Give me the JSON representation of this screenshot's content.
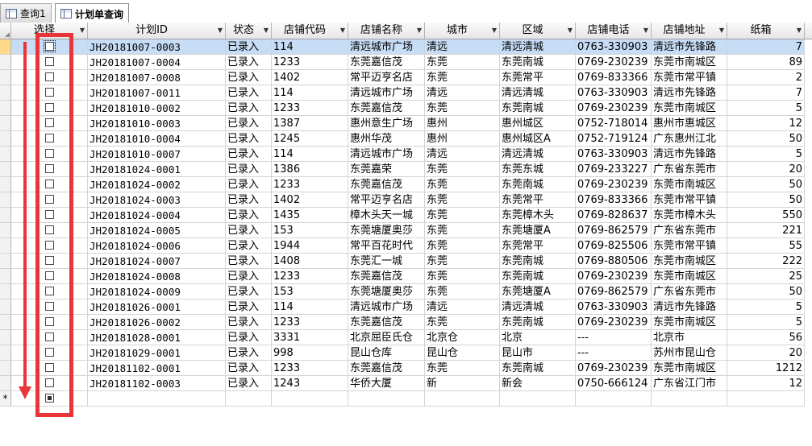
{
  "tabs": [
    {
      "label": "查询1",
      "active": false
    },
    {
      "label": "计划单查询",
      "active": true
    }
  ],
  "columns": [
    {
      "key": "select",
      "label": "选择"
    },
    {
      "key": "plan_id",
      "label": "计划ID"
    },
    {
      "key": "status",
      "label": "状态"
    },
    {
      "key": "store_code",
      "label": "店铺代码"
    },
    {
      "key": "store_name",
      "label": "店铺名称"
    },
    {
      "key": "city",
      "label": "城市"
    },
    {
      "key": "region",
      "label": "区域"
    },
    {
      "key": "phone",
      "label": "店铺电话"
    },
    {
      "key": "address",
      "label": "店铺地址"
    },
    {
      "key": "boxes",
      "label": "纸箱"
    }
  ],
  "rows": [
    [
      "JH20181007-0003",
      "已录入",
      "114",
      "清远城市广场",
      "清远",
      "清远清城",
      "0763-330903",
      "清远市先锋路",
      "7"
    ],
    [
      "JH20181007-0004",
      "已录入",
      "1233",
      "东莞嘉信茂",
      "东莞",
      "东莞南城",
      "0769-230239",
      "东莞市南城区",
      "89"
    ],
    [
      "JH20181007-0008",
      "已录入",
      "1402",
      "常平迈亨名店",
      "东莞",
      "东莞常平",
      "0769-833366",
      "东莞市常平镇",
      "2"
    ],
    [
      "JH20181007-0011",
      "已录入",
      "114",
      "清远城市广场",
      "清远",
      "清远清城",
      "0763-330903",
      "清远市先锋路",
      "7"
    ],
    [
      "JH20181010-0002",
      "已录入",
      "1233",
      "东莞嘉信茂",
      "东莞",
      "东莞南城",
      "0769-230239",
      "东莞市南城区",
      "5"
    ],
    [
      "JH20181010-0003",
      "已录入",
      "1387",
      "惠州意生广场",
      "惠州",
      "惠州城区",
      "0752-718014",
      "惠州市惠城区",
      "12"
    ],
    [
      "JH20181010-0004",
      "已录入",
      "1245",
      "惠州华茂",
      "惠州",
      "惠州城区A",
      "0752-719124",
      "广东惠州江北",
      "50"
    ],
    [
      "JH20181010-0007",
      "已录入",
      "114",
      "清远城市广场",
      "清远",
      "清远清城",
      "0763-330903",
      "清远市先锋路",
      "5"
    ],
    [
      "JH20181024-0001",
      "已录入",
      "1386",
      "东莞嘉荣",
      "东莞",
      "东莞东城",
      "0769-233227",
      "广东省东莞市",
      "20"
    ],
    [
      "JH20181024-0002",
      "已录入",
      "1233",
      "东莞嘉信茂",
      "东莞",
      "东莞南城",
      "0769-230239",
      "东莞市南城区",
      "50"
    ],
    [
      "JH20181024-0003",
      "已录入",
      "1402",
      "常平迈亨名店",
      "东莞",
      "东莞常平",
      "0769-833366",
      "东莞市常平镇",
      "50"
    ],
    [
      "JH20181024-0004",
      "已录入",
      "1435",
      "樟木头天一城",
      "东莞",
      "东莞樟木头",
      "0769-828637",
      "东莞市樟木头",
      "550"
    ],
    [
      "JH20181024-0005",
      "已录入",
      "153",
      "东莞塘厦奥莎",
      "东莞",
      "东莞塘厦A",
      "0769-862579",
      "广东省东莞市",
      "221"
    ],
    [
      "JH20181024-0006",
      "已录入",
      "1944",
      "常平百花时代",
      "东莞",
      "东莞常平",
      "0769-825506",
      "东莞市常平镇",
      "55"
    ],
    [
      "JH20181024-0007",
      "已录入",
      "1408",
      "东莞汇一城",
      "东莞",
      "东莞南城",
      "0769-880506",
      "东莞市南城区",
      "222"
    ],
    [
      "JH20181024-0008",
      "已录入",
      "1233",
      "东莞嘉信茂",
      "东莞",
      "东莞南城",
      "0769-230239",
      "东莞市南城区",
      "25"
    ],
    [
      "JH20181024-0009",
      "已录入",
      "153",
      "东莞塘厦奥莎",
      "东莞",
      "东莞塘厦A",
      "0769-862579",
      "广东省东莞市",
      "50"
    ],
    [
      "JH20181026-0001",
      "已录入",
      "114",
      "清远城市广场",
      "清远",
      "清远清城",
      "0763-330903",
      "清远市先锋路",
      "5"
    ],
    [
      "JH20181026-0002",
      "已录入",
      "1233",
      "东莞嘉信茂",
      "东莞",
      "东莞南城",
      "0769-230239",
      "东莞市南城区",
      "5"
    ],
    [
      "JH20181028-0001",
      "已录入",
      "3331",
      "北京屈臣氏仓",
      "北京仓",
      "北京",
      "---",
      "北京市",
      "56"
    ],
    [
      "JH20181029-0001",
      "已录入",
      "998",
      "昆山仓库",
      "昆山仓",
      "昆山市",
      "---",
      "苏州市昆山仓",
      "20"
    ],
    [
      "JH20181102-0001",
      "已录入",
      "1233",
      "东莞嘉信茂",
      "东莞",
      "东莞南城",
      "0769-230239",
      "东莞市南城区",
      "1212"
    ],
    [
      "JH20181102-0003",
      "已录入",
      "1243",
      "华侨大厦",
      "新",
      "新会",
      "0750-666124",
      "广东省江门市",
      "12"
    ]
  ],
  "new_row_marker": "*",
  "annotation_color": "#e8353a",
  "selected_row_color": "#c7dcf5"
}
